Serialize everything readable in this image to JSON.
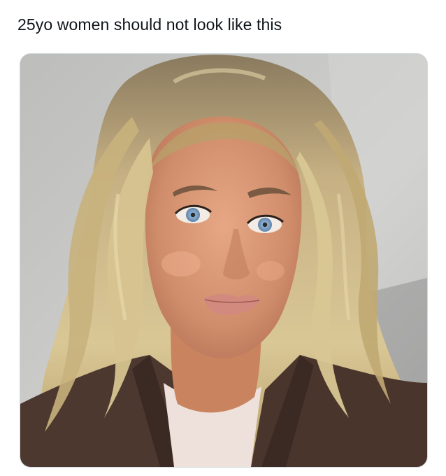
{
  "post": {
    "text": "25yo women should not look like this"
  },
  "media": {
    "alt": "selfie photo",
    "colors": {
      "wall": "#c9c9c7",
      "hair": "#c9b07a",
      "skin": "#d99a78",
      "jacket": "#4f3a31",
      "top": "#efe2dc",
      "eyes": "#7fa2c6"
    }
  }
}
